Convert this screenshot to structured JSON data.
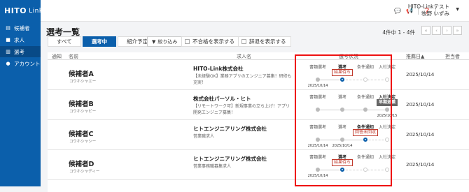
{
  "sidebar": {
    "logo": "HITO",
    "logo_sub": "Link",
    "items": [
      {
        "label": "候補者",
        "icon": "document-icon"
      },
      {
        "label": "求人",
        "icon": "briefcase-icon"
      },
      {
        "label": "選考",
        "icon": "book-icon"
      },
      {
        "label": "アカウント",
        "icon": "person-icon"
      }
    ]
  },
  "header": {
    "user_company": "HITO-Linkテスト",
    "user_name": "牧野 いずみ"
  },
  "page": {
    "title": "選考一覧",
    "tabs": [
      "すべて",
      "選考中",
      "紹介予定"
    ],
    "filter_label": "絞り込み",
    "show_rejected": "不合格を表示する",
    "show_declined": "辞退を表示する",
    "pager_info": "4件中 1 - 4件"
  },
  "table": {
    "headers": {
      "notify": "通知",
      "name": "名前",
      "job": "求人名",
      "status": "選考状況",
      "recommend_date": "推薦日",
      "owner": "担当者"
    },
    "rows": [
      {
        "name": "候補者A",
        "kana": "コウホシャエー",
        "company": "HITO-Link株式会社",
        "job": "【未経験OK】業務アプリのエンジニア募集！研修も充実！",
        "stages": [
          "書類選考",
          "選考",
          "条件通知",
          "入社決定"
        ],
        "badge": "結果待ち",
        "date_doc": "2025/10/14",
        "recommend_date": "2025/10/14"
      },
      {
        "name": "候補者B",
        "kana": "コウホシャビー",
        "company": "株式会社パーソル・ヒト",
        "job": "【リモートワーク可】新規事業の立ち上げ！アプリ開発エンジニア募集！",
        "stages": [
          "書類選考",
          "選考",
          "条件通知",
          "入社決定"
        ],
        "badge": "早期退職",
        "date_final": "2025/10/15",
        "recommend_date": "2025/10/14"
      },
      {
        "name": "候補者C",
        "kana": "コウホシャシー",
        "company": "ヒトエンジニアリング株式会社",
        "job": "営業職求人",
        "stages": [
          "書類選考",
          "選考",
          "条件通知",
          "入社決定"
        ],
        "badge": "回答未回収",
        "date_doc": "2025/10/14",
        "date_sel": "2025/10/14",
        "recommend_date": "2025/10/14"
      },
      {
        "name": "候補者D",
        "kana": "コウホシャディー",
        "company": "ヒトエンジニアリング株式会社",
        "job": "営業事務職募集求人",
        "stages": [
          "書類選考",
          "選考",
          "条件通知",
          "入社決定"
        ],
        "badge": "結果待ち",
        "date_doc": "2025/10/14",
        "recommend_date": "2025/10/14"
      }
    ]
  },
  "colors": {
    "brand": "#0b5fab",
    "highlight": "#e11111"
  }
}
